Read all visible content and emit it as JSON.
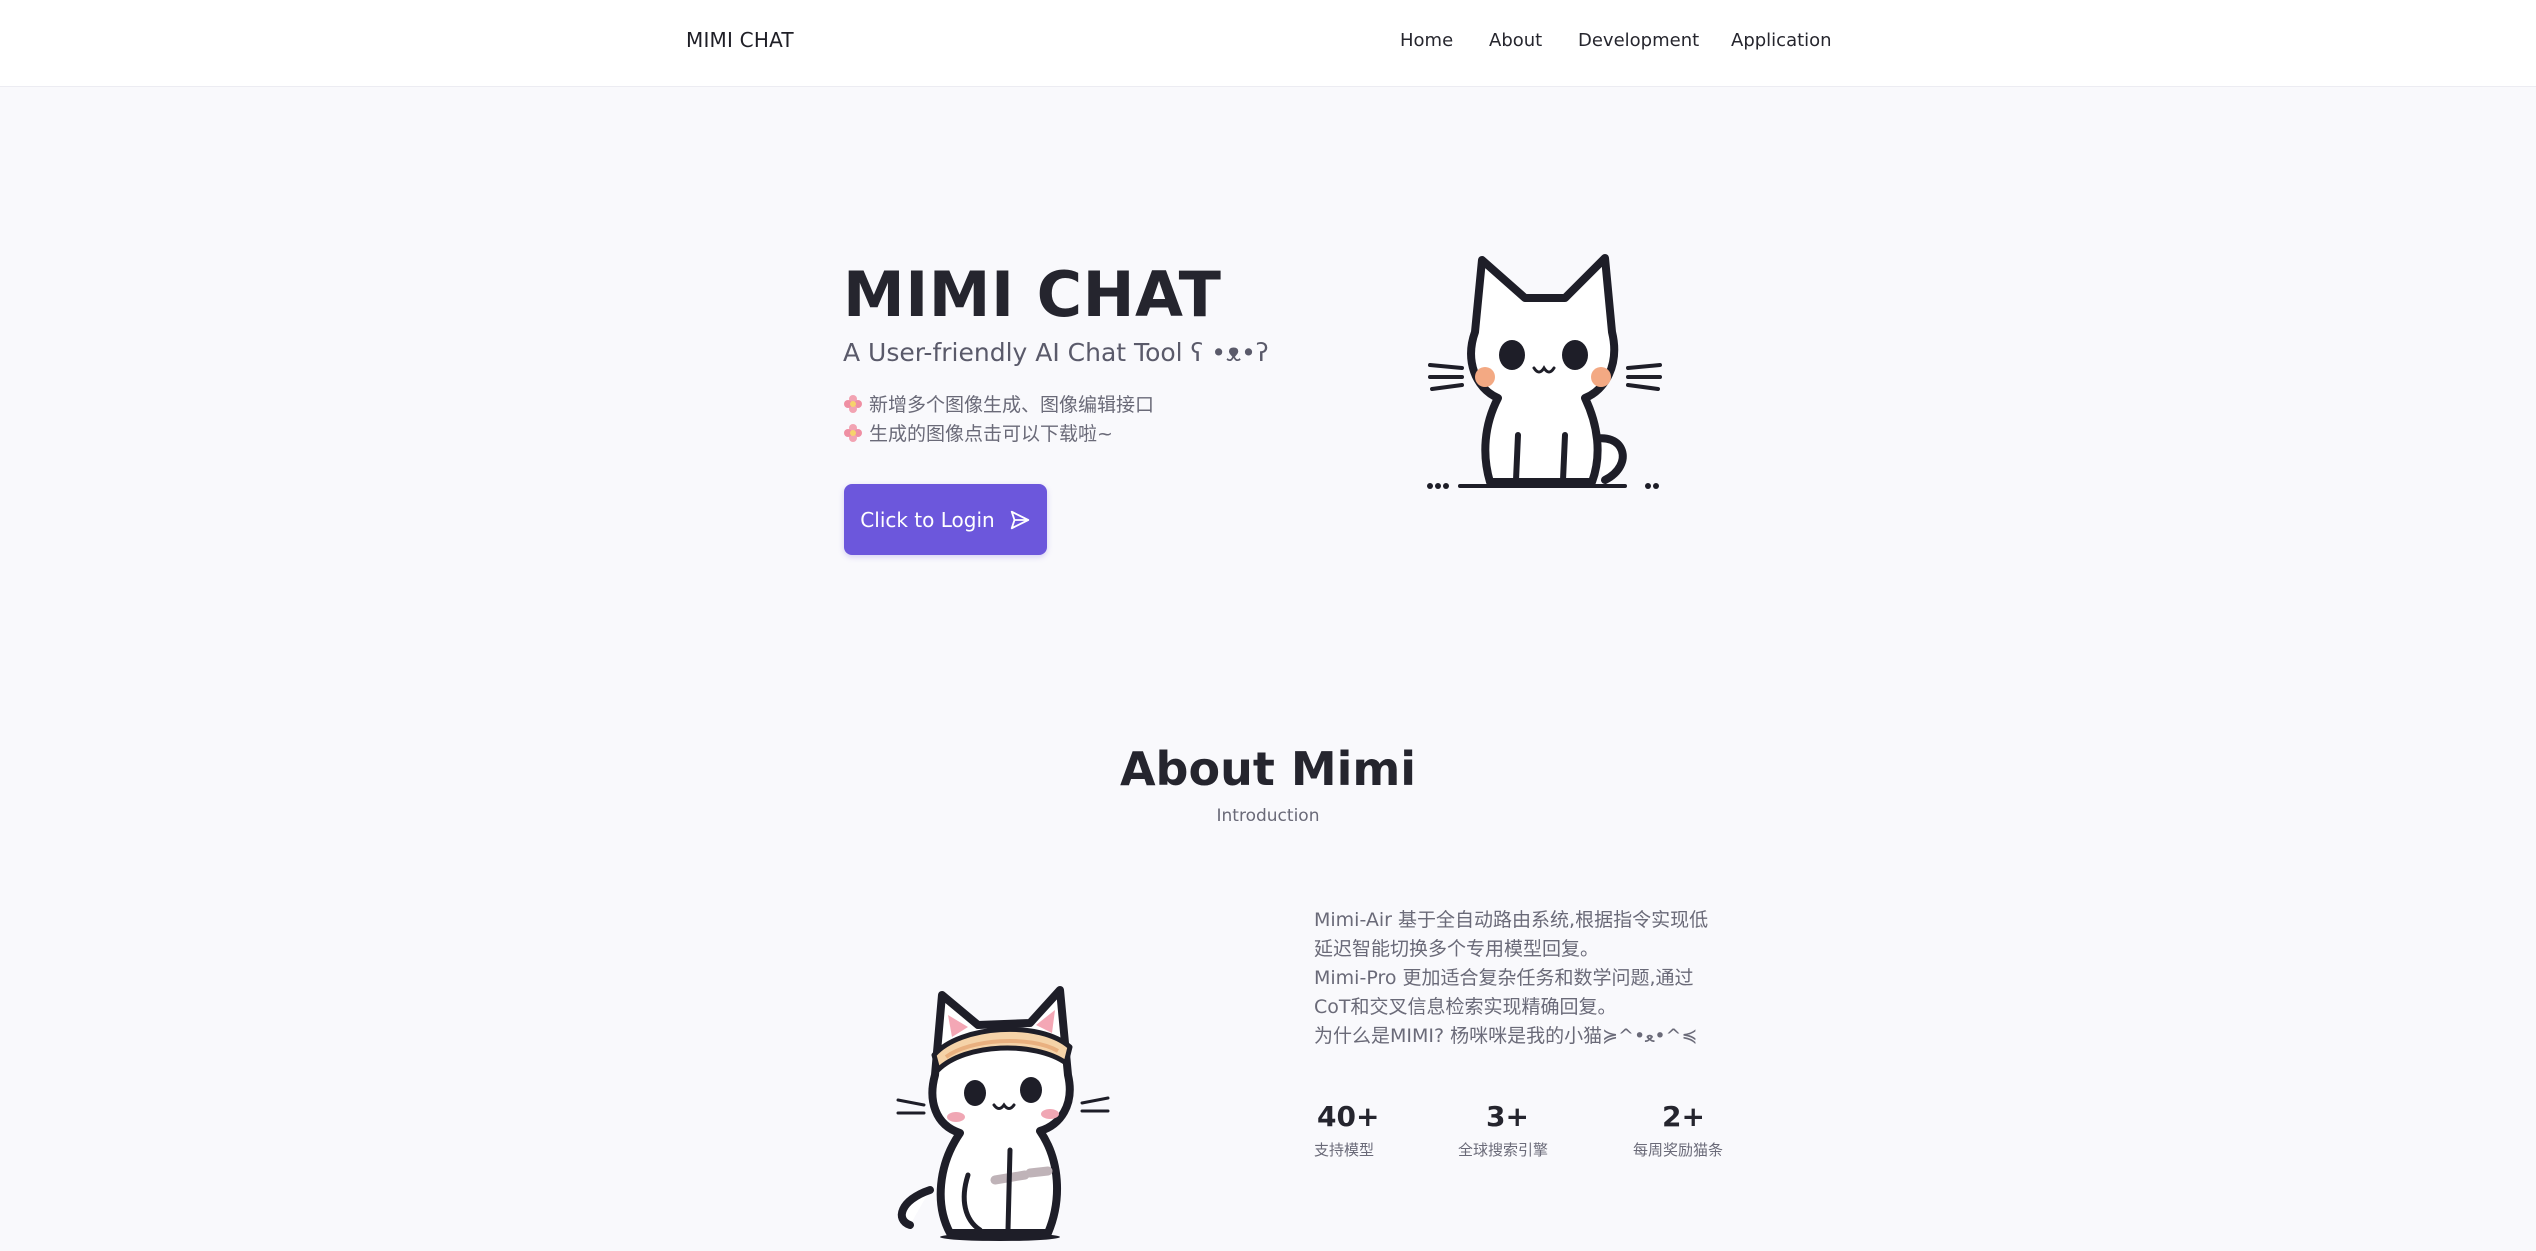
{
  "header": {
    "brand": "MIMI CHAT",
    "nav": {
      "home": "Home",
      "about": "About",
      "development": "Development",
      "application": "Application"
    }
  },
  "hero": {
    "title": "MIMI CHAT",
    "subtitle": "A User-friendly AI Chat Tool ʕ •ᴥ•ʔ",
    "lines": [
      "新增多个图像生成、图像编辑接口",
      "生成的图像点击可以下载啦~"
    ],
    "line_icon": "flower-icon",
    "button_label": "Click to Login",
    "button_icon": "send-icon"
  },
  "about": {
    "title": "About Mimi",
    "subtitle": "Introduction",
    "paragraph_lines": [
      "Mimi-Air 基于全自动路由系统,根据指令实现低",
      "延迟智能切换多个专用模型回复。",
      "Mimi-Pro 更加适合复杂任务和数学问题,通过",
      "CoT和交叉信息检索实现精确回复。",
      "为什么是MIMI? 杨咪咪是我的小猫≽^•ﻌ•^≼"
    ],
    "stats": [
      {
        "value": "40+",
        "label": "支持模型"
      },
      {
        "value": "3+",
        "label": "全球搜索引擎"
      },
      {
        "value": "2+",
        "label": "每周奖励猫条"
      }
    ]
  },
  "colors": {
    "accent": "#6c57dc",
    "background": "#f9f9fc",
    "text_dark": "#25252e",
    "text_muted": "#6a6a78"
  }
}
